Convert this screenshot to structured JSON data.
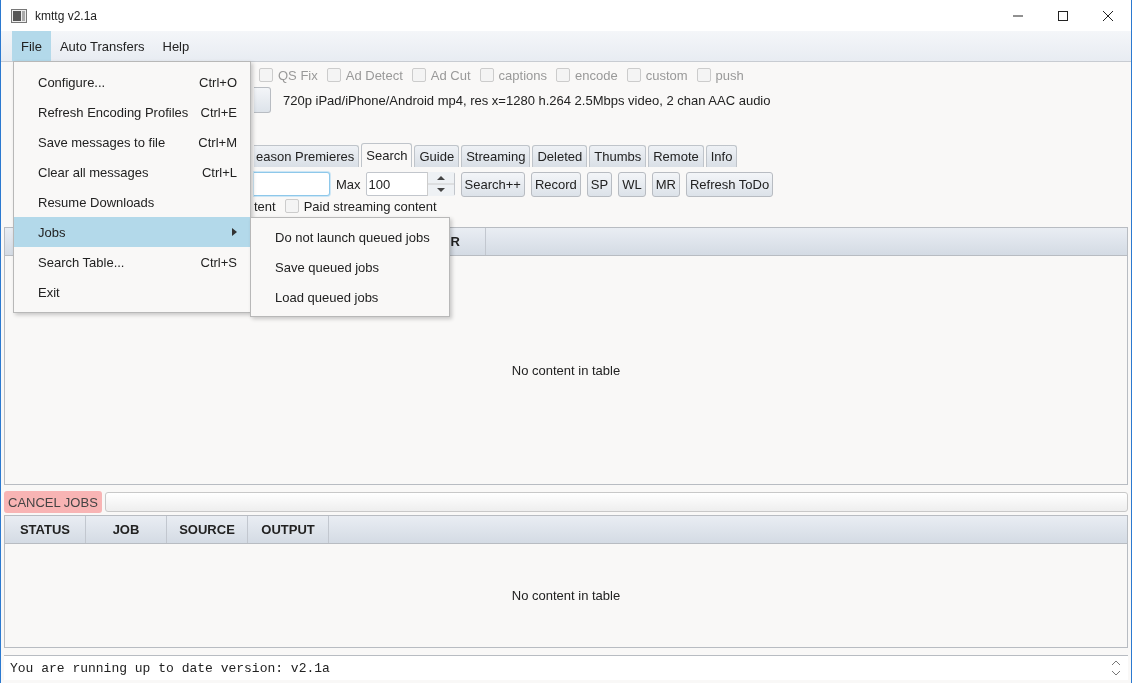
{
  "window": {
    "title": "kmttg v2.1a"
  },
  "menubar": [
    {
      "label": "File",
      "selected": true
    },
    {
      "label": "Auto Transfers",
      "selected": false
    },
    {
      "label": "Help",
      "selected": false
    }
  ],
  "file_menu": [
    {
      "label": "Configure...",
      "shortcut": "Ctrl+O",
      "selected": false
    },
    {
      "label": "Refresh Encoding Profiles",
      "shortcut": "Ctrl+E",
      "selected": false
    },
    {
      "label": "Save messages to file",
      "shortcut": "Ctrl+M",
      "selected": false
    },
    {
      "label": "Clear all messages",
      "shortcut": "Ctrl+L",
      "selected": false
    },
    {
      "label": "Resume Downloads",
      "selected": false
    },
    {
      "label": "Jobs",
      "kind": "submenu",
      "selected": true
    },
    {
      "label": "Search Table...",
      "shortcut": "Ctrl+S",
      "selected": false
    },
    {
      "label": "Exit",
      "selected": false
    }
  ],
  "jobs_submenu": [
    "Do not launch queued jobs",
    "Save queued jobs",
    "Load queued jobs"
  ],
  "options": [
    {
      "label": "QS Fix",
      "checked": false
    },
    {
      "label": "Ad Detect",
      "checked": false
    },
    {
      "label": "Ad Cut",
      "checked": false
    },
    {
      "label": "captions",
      "checked": false
    },
    {
      "label": "encode",
      "checked": false
    },
    {
      "label": "custom",
      "checked": false
    },
    {
      "label": "push",
      "checked": false
    }
  ],
  "encoding": {
    "description": "720p iPad/iPhone/Android mp4, res x=1280 h.264 2.5Mbps video, 2 chan AAC audio"
  },
  "tabs": [
    {
      "label": "eason Premieres",
      "selected": false
    },
    {
      "label": "Search",
      "selected": true
    },
    {
      "label": "Guide",
      "selected": false
    },
    {
      "label": "Streaming",
      "selected": false
    },
    {
      "label": "Deleted",
      "selected": false
    },
    {
      "label": "Thumbs",
      "selected": false
    },
    {
      "label": "Remote",
      "selected": false
    },
    {
      "label": "Info",
      "selected": false
    }
  ],
  "search": {
    "max_label": "Max",
    "max_value": "100",
    "buttons": [
      "Search++",
      "Record",
      "SP",
      "WL",
      "MR",
      "Refresh ToDo"
    ]
  },
  "filters": [
    {
      "label": "tent"
    },
    {
      "label": "Paid streaming content",
      "checked": false
    }
  ],
  "table": {
    "columns": [
      "R"
    ],
    "empty_text": "No content in table"
  },
  "jobs": {
    "cancel_button": "CANCEL JOBS",
    "progress": {
      "level": 0
    },
    "columns": [
      "STATUS",
      "JOB",
      "SOURCE",
      "OUTPUT"
    ],
    "empty_text": "No content in table"
  },
  "messages": [
    "You are running up to date version: v2.1a"
  ]
}
